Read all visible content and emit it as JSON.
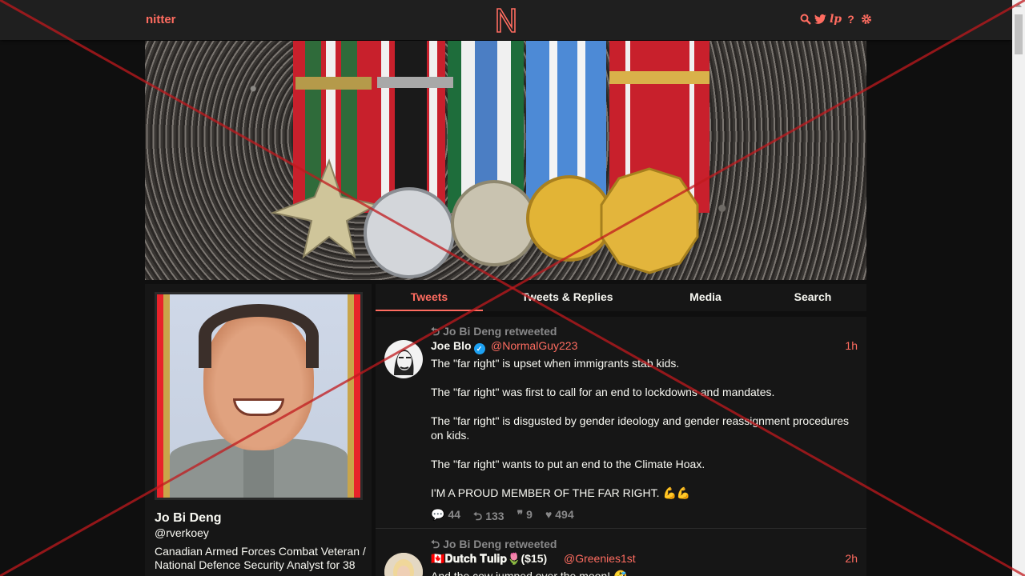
{
  "navbar": {
    "brand": "nitter",
    "logo_letter": "N",
    "icons": [
      "search-icon",
      "twitter-icon",
      "liberapay-icon",
      "help-icon",
      "settings-icon"
    ]
  },
  "profile": {
    "fullname": "Jo Bi Deng",
    "username": "@rverkoey",
    "bio": "Canadian Armed Forces Combat Veteran / National Defence Security Analyst for 38"
  },
  "tabs": [
    {
      "label": "Tweets",
      "active": true
    },
    {
      "label": "Tweets & Replies",
      "active": false
    },
    {
      "label": "Media",
      "active": false
    },
    {
      "label": "Search",
      "active": false
    }
  ],
  "tweets": [
    {
      "retweet_header": "Jo Bi Deng retweeted",
      "fullname": "Joe Blo",
      "verified": true,
      "username": "@NormalGuy223",
      "date": "1h",
      "paragraphs": [
        "The \"far right\" is upset when immigrants stab kids.",
        "The \"far right\" was first to call for an end to lockdowns and mandates.",
        "The \"far right\" is disgusted by gender ideology and gender reassignment procedures on kids.",
        "The \"far right\" wants to put an end to the Climate Hoax.",
        "I'M A PROUD MEMBER OF THE FAR RIGHT. 💪💪"
      ],
      "stats": {
        "replies": "44",
        "retweets": "133",
        "quotes": "9",
        "likes": "494"
      }
    },
    {
      "retweet_header": "Jo Bi Deng retweeted",
      "fullname": "🇨🇦𝐃𝐮𝐭𝐜𝐡 𝐓𝐮𝐥𝐢𝐩🌷($15)",
      "username": "@Greenies1st",
      "date": "2h",
      "paragraphs": [
        "And the cow jumped over the moon! 🤣"
      ]
    }
  ],
  "colors": {
    "accent": "#ff6c60",
    "background": "#0f0f0f",
    "panel": "#161616",
    "muted": "#888889",
    "overlay_x": "#c0191e"
  }
}
